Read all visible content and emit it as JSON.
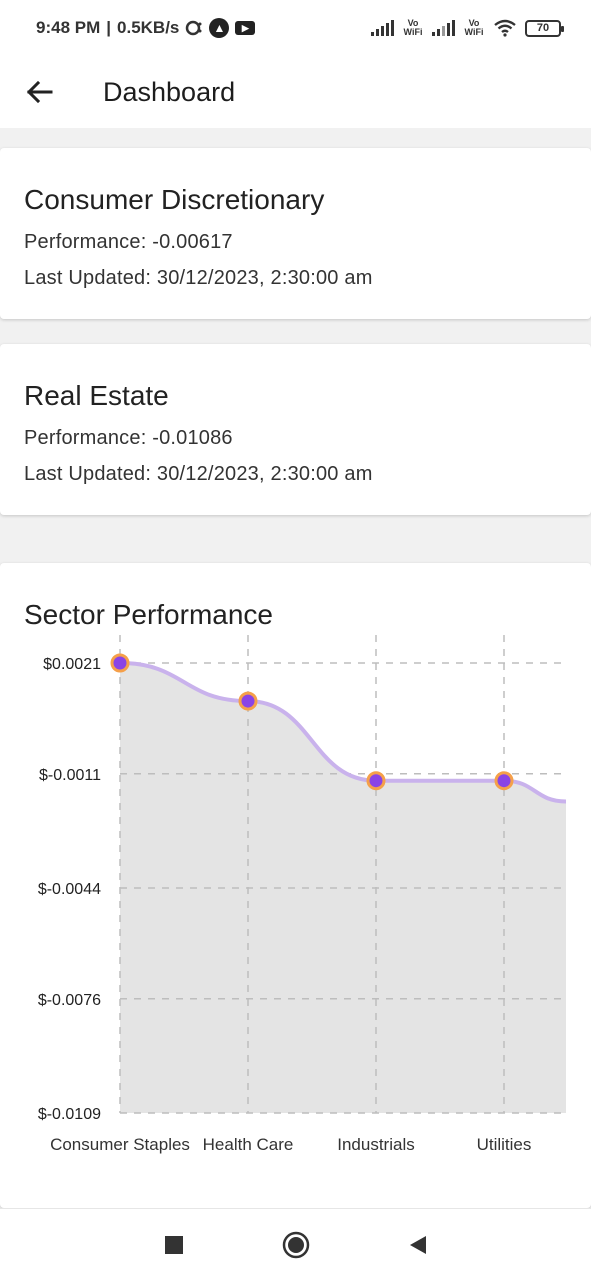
{
  "status_bar": {
    "time": "9:48 PM",
    "speed": "0.5KB/s",
    "vowifi_1": "Vo WiFi",
    "vowifi_2": "Vo WiFi",
    "battery": "70",
    "icons": [
      "chat-bubble-icon",
      "navigation-icon",
      "youtube-icon",
      "signal-icon",
      "wifi-icon",
      "battery-icon"
    ]
  },
  "app_bar": {
    "title": "Dashboard",
    "back_icon": "arrow-left-icon"
  },
  "cards": [
    {
      "title": "Consumer Discretionary",
      "performance": "Performance: -0.00617",
      "updated": "Last Updated: 30/12/2023, 2:30:00 am"
    },
    {
      "title": "Real Estate",
      "performance": "Performance: -0.01086",
      "updated": "Last Updated: 30/12/2023, 2:30:00 am"
    }
  ],
  "chart_data": {
    "type": "area",
    "title": "Sector Performance",
    "xlabel": "",
    "ylabel": "",
    "categories": [
      "Consumer Staples",
      "Health Care",
      "Industrials",
      "Utilities"
    ],
    "values": [
      0.0021,
      0.001,
      -0.0013,
      -0.0013
    ],
    "trailing_value": -0.0019,
    "ylim": [
      -0.0109,
      0.0021
    ],
    "y_ticks": [
      0.0021,
      -0.0011,
      -0.0044,
      -0.0076,
      -0.0109
    ],
    "y_tick_labels": [
      "$0.0021",
      "$-0.0011",
      "$-0.0044",
      "$-0.0076",
      "$-0.0109"
    ],
    "grid": true,
    "colors": {
      "area": "#e4e4e4",
      "line": "#c9b2ec",
      "point_fill": "#8a44e6",
      "point_stroke": "#f5a04a",
      "grid": "#bdbdbd"
    }
  },
  "nav_bar": {
    "icons": [
      "recents-square-icon",
      "home-circle-icon",
      "back-triangle-icon"
    ]
  }
}
